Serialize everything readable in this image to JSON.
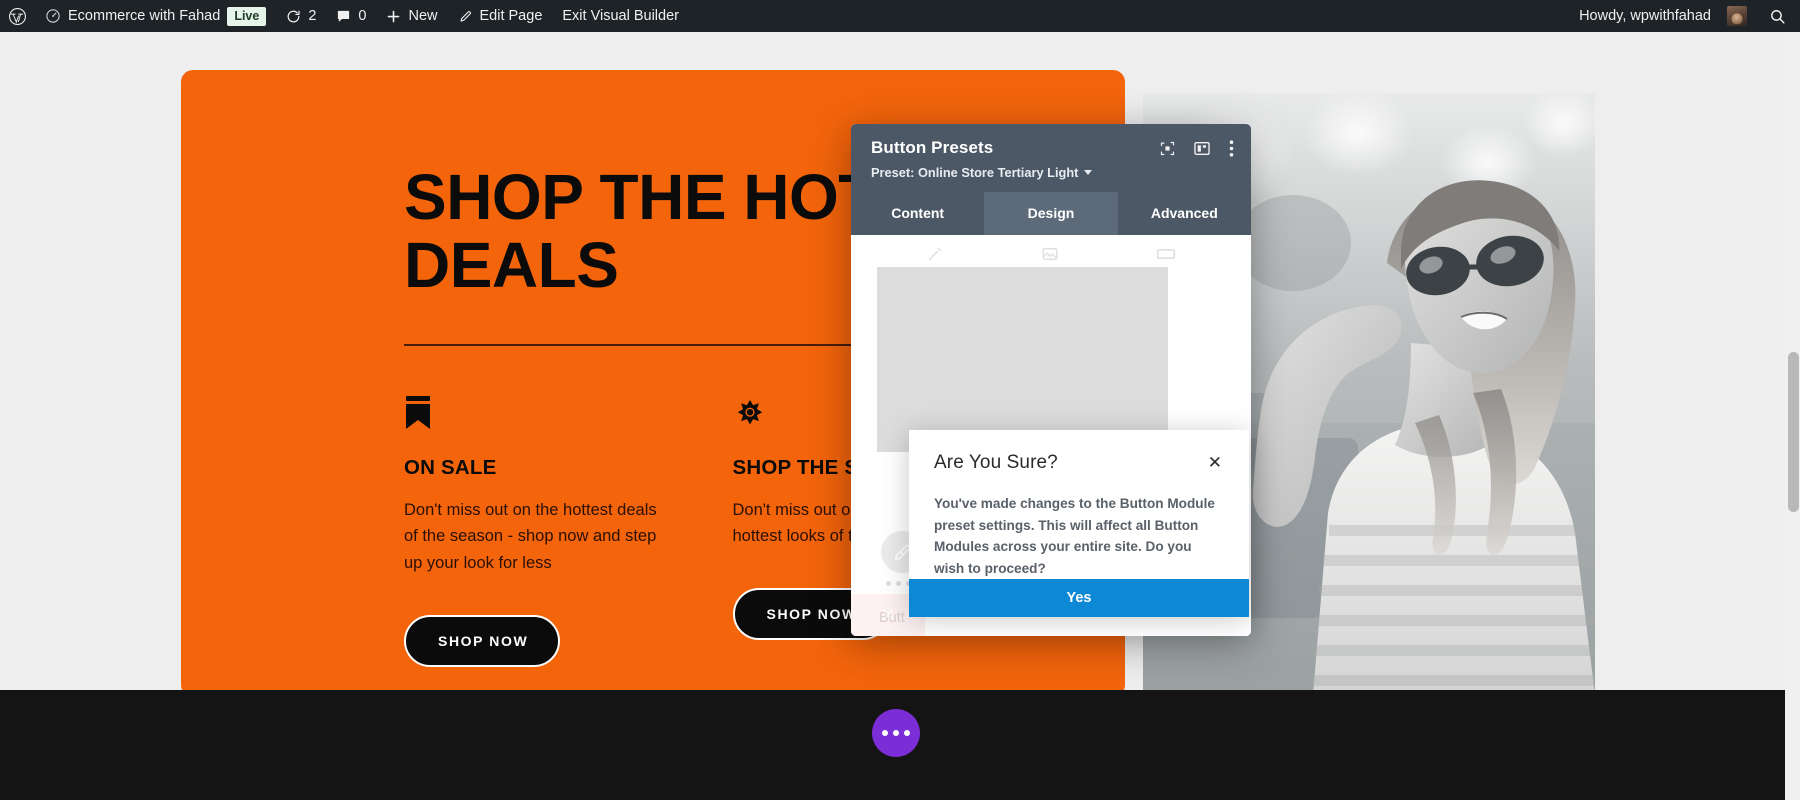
{
  "adminbar": {
    "wp_logo_icon": "wordpress-logo-icon",
    "site_icon": "dashboard-speedometer-icon",
    "site_name": "Ecommerce with Fahad",
    "live_badge": "Live",
    "updates_icon": "updates-refresh-icon",
    "updates_count": "2",
    "comments_icon": "comment-bubble-icon",
    "comments_count": "0",
    "new_icon": "plus-icon",
    "new_label": "New",
    "edit_icon": "pencil-icon",
    "edit_label": "Edit Page",
    "exit_label": "Exit Visual Builder",
    "howdy": "Howdy, wpwithfahad",
    "avatar": "user-avatar",
    "search_icon": "search-icon"
  },
  "hero": {
    "title": "SHOP THE HOTTEST\nDEALS",
    "columns": [
      {
        "icon": "bookmark-icon",
        "title": "ON SALE",
        "body": "Don't miss out on the hottest deals of the season - shop now and step up your look for less",
        "button": "SHOP NOW"
      },
      {
        "icon": "sun-gear-icon",
        "title": "SHOP THE SEASON",
        "body": "Don't miss out on this season's hottest looks of the season",
        "button": "SHOP NOW"
      }
    ],
    "photo_alt": "woman-in-sunglasses-photo"
  },
  "fab": {
    "icon": "three-dots-icon"
  },
  "divi_modal": {
    "title": "Button Presets",
    "preset_label": "Preset: Online Store Tertiary Light",
    "header_icons": [
      "focus-target-icon",
      "layout-panel-icon",
      "vertical-dots-icon"
    ],
    "tabs": [
      {
        "label": "Content",
        "active": false
      },
      {
        "label": "Design",
        "active": true
      },
      {
        "label": "Advanced",
        "active": false
      }
    ],
    "partial_label": "Butt",
    "tool_icon": "eyedropper-icon",
    "close_icon": "close-x-icon"
  },
  "confirm_dialog": {
    "title": "Are You Sure?",
    "close_icon": "close-x-icon",
    "message": "You've made changes to the Button Module preset settings. This will affect all Button Modules across your entire site. Do you wish to proceed?",
    "confirm_label": "Yes"
  },
  "colors": {
    "adminbar_bg": "#1d2327",
    "hero_orange": "#f3640b",
    "divi_header": "#4c5866",
    "divi_tab_active": "#5c6a7a",
    "confirm_blue": "#0c88d6",
    "fab_purple": "#7b2ed6",
    "footer_dark": "#141414"
  },
  "scrollbar": {
    "name": "page-vertical-scrollbar"
  }
}
